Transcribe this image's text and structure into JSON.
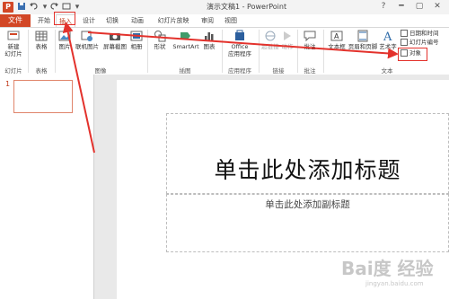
{
  "titlebar": {
    "app_icon": "P",
    "window_title": "演示文稿1 - PowerPoint",
    "quick_access": [
      "save-icon",
      "undo-icon",
      "redo-icon",
      "present-icon",
      "more-icon"
    ],
    "controls": [
      "?",
      "━",
      "▢",
      "✕"
    ]
  },
  "tabs": {
    "file": "文件",
    "items": [
      "开始",
      "插入",
      "设计",
      "切换",
      "动画",
      "幻灯片放映",
      "审阅",
      "视图"
    ],
    "active": "插入"
  },
  "ribbon": {
    "groups": {
      "slides": {
        "label": "幻灯片",
        "buttons": [
          "新建\n幻灯片"
        ]
      },
      "table": {
        "label": "表格",
        "buttons": [
          "表格"
        ]
      },
      "images": {
        "label": "图像",
        "buttons": [
          "图片",
          "联机图片",
          "屏幕截图",
          "相册"
        ]
      },
      "illustrations": {
        "label": "插图",
        "buttons": [
          "形状",
          "SmartArt",
          "图表"
        ]
      },
      "apps": {
        "label": "应用程序",
        "buttons": [
          "Office\n应用程序"
        ]
      },
      "links": {
        "label": "链接",
        "buttons": [
          "超链接",
          "动作"
        ]
      },
      "comments": {
        "label": "批注",
        "buttons": [
          "批注"
        ]
      },
      "text": {
        "label": "文本",
        "buttons": [
          "文本框",
          "页眉和页脚",
          "艺术字"
        ],
        "small": [
          "日期和时间",
          "幻灯片编号",
          "对象"
        ]
      }
    }
  },
  "thumbpane": {
    "slide_number": "1"
  },
  "slide": {
    "title": "单击此处添加标题",
    "subtitle": "单击此处添加副标题"
  },
  "watermark": {
    "text": "Bai度 经验",
    "sub": "jingyan.baidu.com"
  },
  "colors": {
    "accent": "#d24726",
    "annotation": "#e3322c"
  }
}
